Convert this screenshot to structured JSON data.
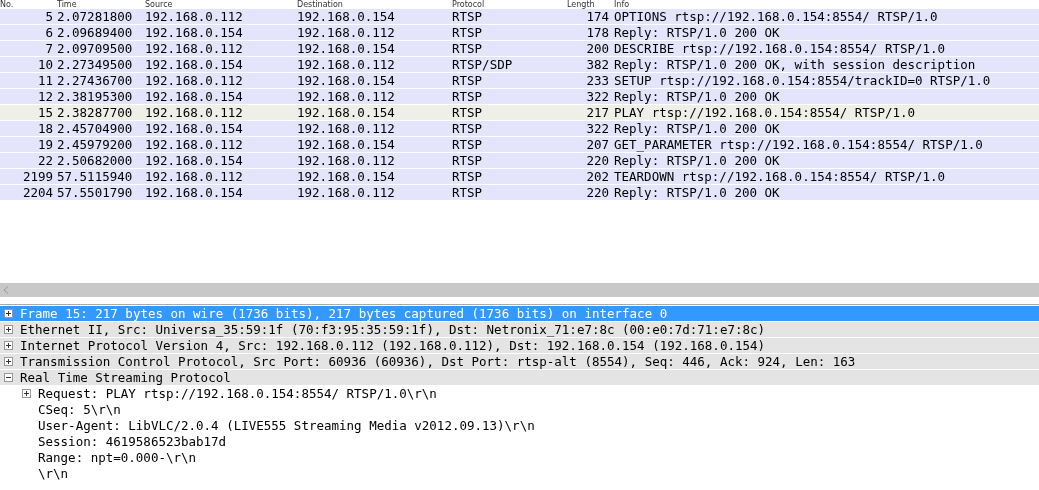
{
  "packet_list": {
    "columns": [
      "No.",
      "Time",
      "Source",
      "Destination",
      "Protocol",
      "Length",
      "Info"
    ],
    "rows": [
      {
        "no": "5",
        "time": "2.07281800",
        "source": "192.168.0.112",
        "destination": "192.168.0.154",
        "protocol": "RTSP",
        "length": "174",
        "info": "OPTIONS rtsp://192.168.0.154:8554/ RTSP/1.0",
        "selected": false
      },
      {
        "no": "6",
        "time": "2.09689400",
        "source": "192.168.0.154",
        "destination": "192.168.0.112",
        "protocol": "RTSP",
        "length": "178",
        "info": "Reply: RTSP/1.0 200 OK",
        "selected": false
      },
      {
        "no": "7",
        "time": "2.09709500",
        "source": "192.168.0.112",
        "destination": "192.168.0.154",
        "protocol": "RTSP",
        "length": "200",
        "info": "DESCRIBE rtsp://192.168.0.154:8554/ RTSP/1.0",
        "selected": false
      },
      {
        "no": "10",
        "time": "2.27349500",
        "source": "192.168.0.154",
        "destination": "192.168.0.112",
        "protocol": "RTSP/SDP",
        "length": "382",
        "info": "Reply: RTSP/1.0 200 OK, with session description",
        "selected": false
      },
      {
        "no": "11",
        "time": "2.27436700",
        "source": "192.168.0.112",
        "destination": "192.168.0.154",
        "protocol": "RTSP",
        "length": "233",
        "info": "SETUP rtsp://192.168.0.154:8554/trackID=0 RTSP/1.0",
        "selected": false
      },
      {
        "no": "12",
        "time": "2.38195300",
        "source": "192.168.0.154",
        "destination": "192.168.0.112",
        "protocol": "RTSP",
        "length": "322",
        "info": "Reply: RTSP/1.0 200 OK",
        "selected": false
      },
      {
        "no": "15",
        "time": "2.38287700",
        "source": "192.168.0.112",
        "destination": "192.168.0.154",
        "protocol": "RTSP",
        "length": "217",
        "info": "PLAY rtsp://192.168.0.154:8554/ RTSP/1.0",
        "selected": true
      },
      {
        "no": "18",
        "time": "2.45704900",
        "source": "192.168.0.154",
        "destination": "192.168.0.112",
        "protocol": "RTSP",
        "length": "322",
        "info": "Reply: RTSP/1.0 200 OK",
        "selected": false
      },
      {
        "no": "19",
        "time": "2.45979200",
        "source": "192.168.0.112",
        "destination": "192.168.0.154",
        "protocol": "RTSP",
        "length": "207",
        "info": "GET_PARAMETER rtsp://192.168.0.154:8554/ RTSP/1.0",
        "selected": false
      },
      {
        "no": "22",
        "time": "2.50682000",
        "source": "192.168.0.154",
        "destination": "192.168.0.112",
        "protocol": "RTSP",
        "length": "220",
        "info": "Reply: RTSP/1.0 200 OK",
        "selected": false
      },
      {
        "no": "2199",
        "time": "57.5115940",
        "source": "192.168.0.112",
        "destination": "192.168.0.154",
        "protocol": "RTSP",
        "length": "202",
        "info": "TEARDOWN rtsp://192.168.0.154:8554/ RTSP/1.0",
        "selected": false
      },
      {
        "no": "2204",
        "time": "57.5501790",
        "source": "192.168.0.154",
        "destination": "192.168.0.112",
        "protocol": "RTSP",
        "length": "220",
        "info": "Reply: RTSP/1.0 200 OK",
        "selected": false
      }
    ]
  },
  "details": [
    {
      "text": "Frame 15: 217 bytes on wire (1736 bits), 217 bytes captured (1736 bits) on interface 0",
      "expanded": false,
      "selected": true
    },
    {
      "text": "Ethernet II, Src: Universa_35:59:1f (70:f3:95:35:59:1f), Dst: Netronix_71:e7:8c (00:e0:7d:71:e7:8c)",
      "expanded": false,
      "selected": false
    },
    {
      "text": "Internet Protocol Version 4, Src: 192.168.0.112 (192.168.0.112), Dst: 192.168.0.154 (192.168.0.154)",
      "expanded": false,
      "selected": false
    },
    {
      "text": "Transmission Control Protocol, Src Port: 60936 (60936), Dst Port: rtsp-alt (8554), Seq: 446, Ack: 924, Len: 163",
      "expanded": false,
      "selected": false
    },
    {
      "text": "Real Time Streaming Protocol",
      "expanded": true,
      "selected": false,
      "children": [
        {
          "text": "Request: PLAY rtsp://192.168.0.154:8554/ RTSP/1.0\\r\\n",
          "expanded": false,
          "selected": false
        },
        {
          "text": "CSeq: 5\\r\\n",
          "selected": false
        },
        {
          "text": "User-Agent: LibVLC/2.0.4 (LIVE555 Streaming Media v2012.09.13)\\r\\n",
          "selected": false
        },
        {
          "text": "Session: 4619586523bab17d",
          "selected": false
        },
        {
          "text": "Range: npt=0.000-\\r\\n",
          "selected": false
        },
        {
          "text": "\\r\\n",
          "selected": false
        }
      ]
    }
  ]
}
